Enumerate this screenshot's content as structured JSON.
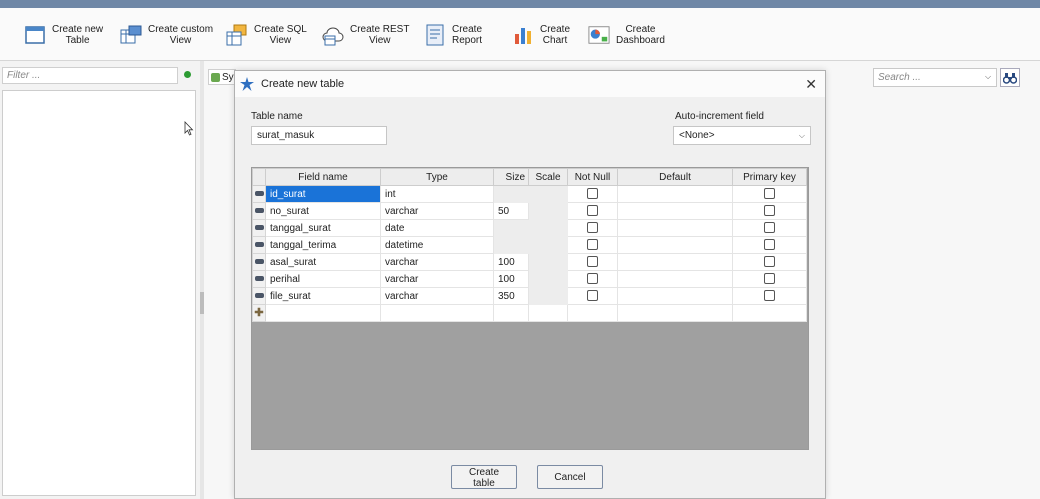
{
  "toolbar": {
    "buttons": [
      {
        "label_line1": "Create new",
        "label_line2": "Table",
        "icon": "table-icon"
      },
      {
        "label_line1": "Create custom",
        "label_line2": "View",
        "icon": "custom-view-icon"
      },
      {
        "label_line1": "Create SQL",
        "label_line2": "View",
        "icon": "sql-view-icon"
      },
      {
        "label_line1": "Create REST",
        "label_line2": "View",
        "icon": "rest-view-icon"
      },
      {
        "label_line1": "Create",
        "label_line2": "Report",
        "icon": "report-icon"
      },
      {
        "label_line1": "Create",
        "label_line2": "Chart",
        "icon": "chart-icon"
      },
      {
        "label_line1": "Create",
        "label_line2": "Dashboard",
        "icon": "dashboard-icon"
      }
    ]
  },
  "left_panel": {
    "filter_placeholder": "Filter ..."
  },
  "main": {
    "tab_label": "Sy",
    "search_placeholder": "Search ..."
  },
  "dialog": {
    "title": "Create new table",
    "table_name_label": "Table name",
    "table_name_value": "surat_masuk",
    "auto_increment_label": "Auto-increment field",
    "auto_increment_value": "<None>",
    "columns": {
      "field_name": "Field name",
      "type": "Type",
      "size": "Size",
      "scale": "Scale",
      "not_null": "Not Null",
      "default": "Default",
      "primary_key": "Primary key"
    },
    "rows": [
      {
        "field": "id_surat",
        "type": "int",
        "size": ""
      },
      {
        "field": "no_surat",
        "type": "varchar",
        "size": "50"
      },
      {
        "field": "tanggal_surat",
        "type": "date",
        "size": ""
      },
      {
        "field": "tanggal_terima",
        "type": "datetime",
        "size": ""
      },
      {
        "field": "asal_surat",
        "type": "varchar",
        "size": "100"
      },
      {
        "field": "perihal",
        "type": "varchar",
        "size": "100"
      },
      {
        "field": "file_surat",
        "type": "varchar",
        "size": "350"
      }
    ],
    "create_button": "Create table",
    "cancel_button": "Cancel"
  },
  "colors": {
    "accent_blue": "#1a73d8",
    "titlebar": "#6f87a6"
  }
}
